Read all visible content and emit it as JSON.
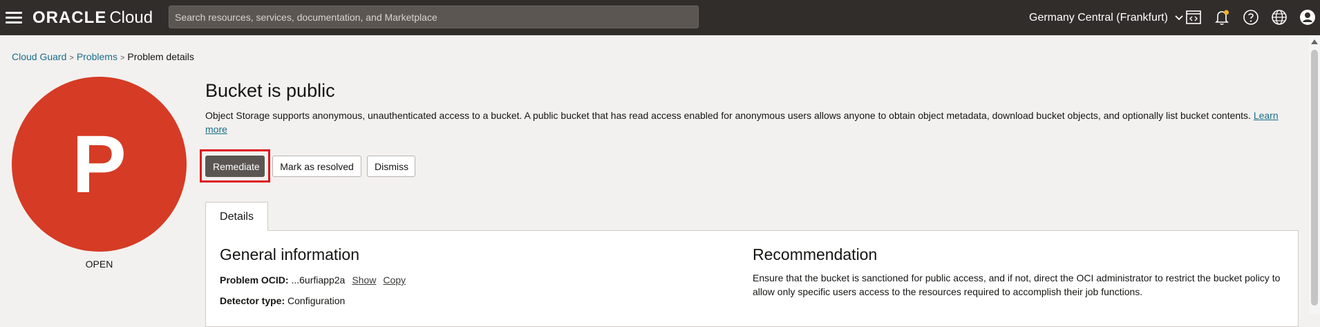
{
  "header": {
    "brand": "ORACLE",
    "product": "Cloud",
    "search_placeholder": "Search resources, services, documentation, and Marketplace",
    "region": "Germany Central (Frankfurt)"
  },
  "breadcrumb": {
    "items": [
      "Cloud Guard",
      "Problems"
    ],
    "current": "Problem details"
  },
  "avatar": {
    "letter": "P",
    "status": "OPEN",
    "color": "#d63b25"
  },
  "problem": {
    "title": "Bucket is public",
    "description": "Object Storage supports anonymous, unauthenticated access to a bucket. A public bucket that has read access enabled for anonymous users allows anyone to obtain object metadata, download bucket objects, and optionally list bucket contents.",
    "learn_more": "Learn more"
  },
  "actions": {
    "remediate": "Remediate",
    "resolve": "Mark as resolved",
    "dismiss": "Dismiss"
  },
  "tabs": {
    "details": "Details"
  },
  "general": {
    "heading": "General information",
    "ocid_label": "Problem OCID:",
    "ocid_value": "...6urfiapp2a",
    "show": "Show",
    "copy": "Copy",
    "detector_label": "Detector type:",
    "detector_value": "Configuration"
  },
  "recommendation": {
    "heading": "Recommendation",
    "text": "Ensure that the bucket is sanctioned for public access, and if not, direct the OCI administrator to restrict the bucket policy to allow only specific users access to the resources required to accomplish their job functions."
  },
  "icons": [
    "menu-icon",
    "code-editor-icon",
    "bell-icon",
    "help-icon",
    "globe-icon",
    "user-icon",
    "chevron-down-icon"
  ]
}
